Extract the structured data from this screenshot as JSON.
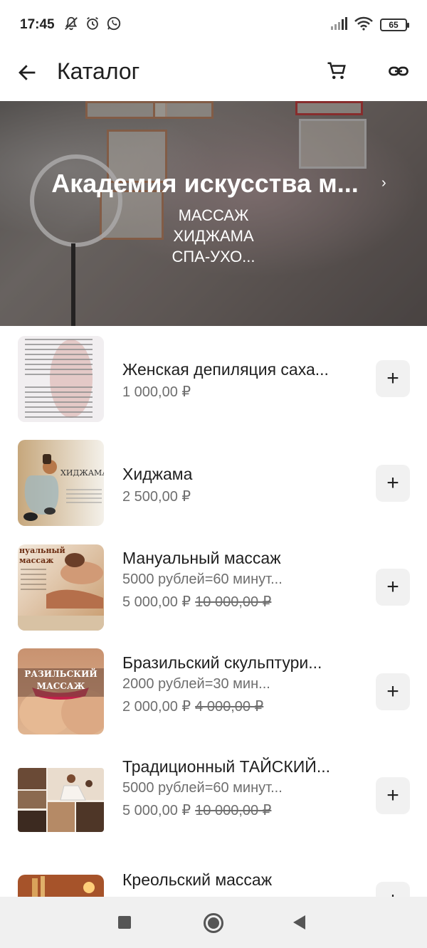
{
  "status_bar": {
    "time": "17:45",
    "battery": "65",
    "icons": [
      "mute-icon",
      "alarm-icon",
      "whatsapp-icon",
      "signal-icon",
      "wifi-icon",
      "battery-icon"
    ]
  },
  "app_bar": {
    "title": "Каталог",
    "icons": [
      "back-arrow-icon",
      "cart-icon",
      "link-icon"
    ]
  },
  "banner": {
    "title": "Академия искусства м...",
    "subtitle": "МАССАЖ\nХИДЖАМА\nСПА-УХО...",
    "chevron": "›"
  },
  "products": [
    {
      "name": "Женская депиляция саха...",
      "description": "",
      "price": "1 000,00 ₽",
      "old_price": "",
      "add_label": "+"
    },
    {
      "name": "Хиджама",
      "description": "",
      "price": "2 500,00 ₽",
      "old_price": "",
      "add_label": "+"
    },
    {
      "name": "Мануальный массаж",
      "description": "5000 рублей=60 минут...",
      "price": "5 000,00 ₽",
      "old_price": "10 000,00 ₽",
      "add_label": "+"
    },
    {
      "name": "Бразильский  скульптури...",
      "description": "2000 рублей=30 мин...",
      "price": "2 000,00 ₽",
      "old_price": "4 000,00 ₽",
      "add_label": "+"
    },
    {
      "name": "Традиционный ТАЙСКИЙ...",
      "description": "5000 рублей=60 минут...",
      "price": "5 000,00 ₽",
      "old_price": "10 000,00 ₽",
      "add_label": "+"
    },
    {
      "name": "Креольский массаж",
      "description": "",
      "price": "",
      "old_price": "",
      "add_label": "+"
    }
  ],
  "thumb_texts": {
    "hijama": "ХИДЖАМА",
    "manual": "нуальный массаж",
    "brazil": "РАЗИЛЬСКИЙ МАССАЖ"
  },
  "colors": {
    "accent_text": "#1f1f1f",
    "secondary_text": "#6e6e6e",
    "button_bg": "#f1f1f1"
  }
}
